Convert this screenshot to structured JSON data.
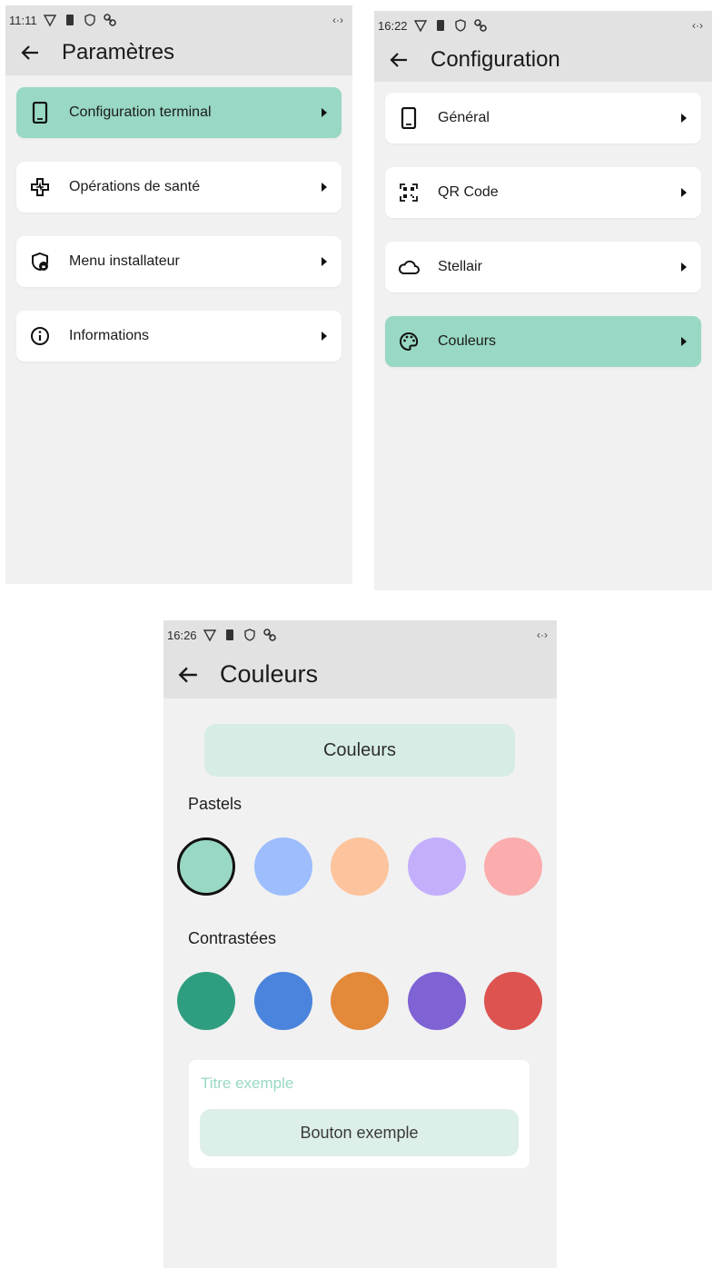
{
  "screens": {
    "parametres": {
      "status": {
        "time": "11:11",
        "network": "‹·›"
      },
      "title": "Paramètres",
      "items": [
        {
          "label": "Configuration terminal",
          "icon": "smartphone-icon",
          "active": true
        },
        {
          "label": "Opérations de santé",
          "icon": "medical-cross-icon",
          "active": false
        },
        {
          "label": "Menu installateur",
          "icon": "shield-lock-icon",
          "active": false
        },
        {
          "label": "Informations",
          "icon": "info-icon",
          "active": false
        }
      ]
    },
    "configuration": {
      "status": {
        "time": "16:22",
        "network": "‹·›"
      },
      "title": "Configuration",
      "items": [
        {
          "label": "Général",
          "icon": "smartphone-icon",
          "active": false
        },
        {
          "label": "QR Code",
          "icon": "qr-code-icon",
          "active": false
        },
        {
          "label": "Stellair",
          "icon": "cloud-icon",
          "active": false
        },
        {
          "label": "Couleurs",
          "icon": "palette-icon",
          "active": true
        }
      ]
    },
    "couleurs": {
      "status": {
        "time": "16:26",
        "network": "‹·›"
      },
      "title": "Couleurs",
      "header_button": "Couleurs",
      "pastels_label": "Pastels",
      "pastels": [
        "#98d8c4",
        "#9dbdfd",
        "#fdc39c",
        "#c3affc",
        "#fbacac"
      ],
      "selected_pastel": 0,
      "contrasted_label": "Contrastées",
      "contrasted": [
        "#2f9e80",
        "#4a84dc",
        "#e3893a",
        "#7f62d4",
        "#dc5350"
      ],
      "example_title": "Titre exemple",
      "example_button": "Bouton exemple"
    }
  },
  "colors": {
    "accent": "#98d8c4",
    "background": "#f1f1f1",
    "topbar": "#e2e2e2"
  }
}
